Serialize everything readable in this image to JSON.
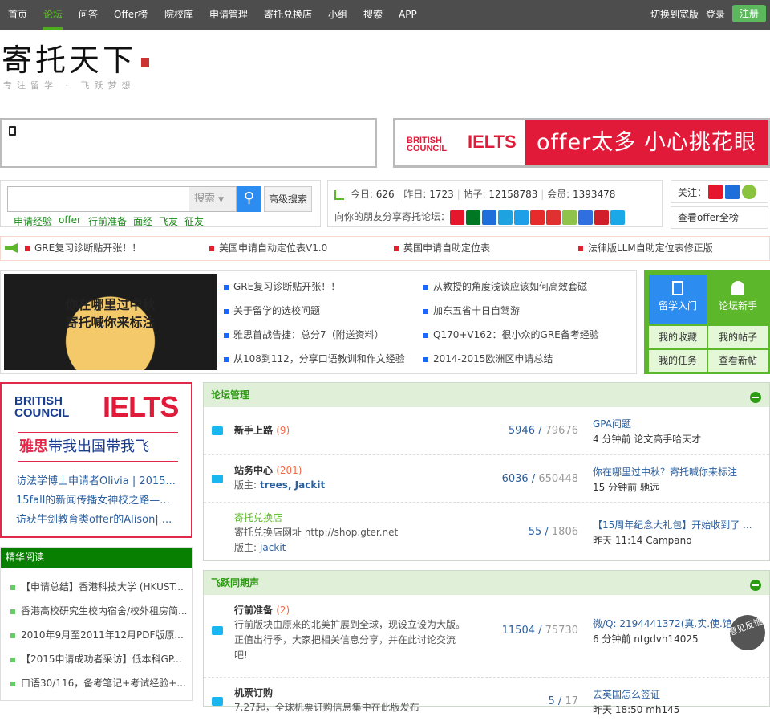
{
  "nav": {
    "items": [
      "首页",
      "论坛",
      "问答",
      "Offer榜",
      "院校库",
      "申请管理",
      "寄托兑换店",
      "小组",
      "搜索",
      "APP"
    ],
    "active": 1,
    "switch": "切换到宽版",
    "login": "登录",
    "register": "注册"
  },
  "logo": {
    "title": "寄托天下",
    "slogan": "专注留学 · 飞跃梦想"
  },
  "ad_top": {
    "brand1": "BRITISH COUNCIL",
    "brand2": "IELTS",
    "slogan": "offer太多  小心挑花眼"
  },
  "search": {
    "placeholder": "",
    "type": "搜索",
    "advanced": "高级搜索",
    "keywords": [
      "申请经验",
      "offer",
      "行前准备",
      "面经",
      "飞友",
      "征友"
    ]
  },
  "stats": {
    "today_label": "今日:",
    "today": "626",
    "yesterday_label": "昨日:",
    "yesterday": "1723",
    "posts_label": "帖子:",
    "posts": "12158783",
    "members_label": "会员:",
    "members": "1393478",
    "share_label": "向你的朋友分享寄托论坛："
  },
  "share_colors": [
    "#e6162d",
    "#007722",
    "#1e6fd9",
    "#1fa3e0",
    "#1ea0e8",
    "#e52b2b",
    "#e03030",
    "#8fc34a",
    "#2f6fe0",
    "#d01f2b",
    "#1aa8e8"
  ],
  "follow": {
    "label": "关注：",
    "offer_all": "查看offer全榜"
  },
  "ticker": [
    "GRE复习诊断贴开张！！",
    "美国申请自动定位表V1.0",
    "英国申请自助定位表",
    "法律版LLM自助定位表修正版"
  ],
  "banner": {
    "line1": "你在哪里过中秋",
    "line2": "寄托喊你来标注"
  },
  "headlines": [
    "GRE复习诊断贴开张！！",
    "从教授的角度浅谈应该如何高效套磁",
    "关于留学的选校问题",
    "加东五省十日自驾游",
    "雅思首战告捷：总分7（附送资料）",
    "Q170+V162：很小众的GRE备考经验",
    "从108到112，分享口语教训和作文经验",
    "2014-2015欧洲区申请总结"
  ],
  "quick": {
    "intro": "留学入门",
    "newbie": "论坛新手",
    "fav": "我的收藏",
    "myposts": "我的帖子",
    "tasks": "我的任务",
    "newposts": "查看新帖"
  },
  "ielts_box": {
    "brand1": "BRITISH COUNCIL",
    "brand2": "IELTS",
    "slogan_red": "雅思",
    "slogan": "带我出国带我飞",
    "links": [
      "访法学博士申请者Olivia | 2015...",
      "15fall的新闻传播女神校之路—...",
      "访获牛剑教育类offer的Alison| ..."
    ]
  },
  "featured": {
    "title": "精华阅读",
    "items": [
      "【申请总结】香港科技大学 (HKUST...",
      "香港高校研究生校内宿舍/校外租房简...",
      "2010年9月至2011年12月PDF版原...",
      "【2015申请成功者采访】低本科GP...",
      "口语30/116，备考笔记+考试经验+..."
    ]
  },
  "sections": [
    {
      "title": "论坛管理",
      "forums": [
        {
          "name": "新手上路",
          "count": "(9)",
          "threads": "5946",
          "posts": "79676",
          "last_title": "GPA问题",
          "last_meta": "4 分钟前 论文高手哈天才"
        },
        {
          "name": "站务中心",
          "count": "(201)",
          "mod_label": "版主:",
          "mods": "trees, Jackit",
          "threads": "6036",
          "posts": "650448",
          "last_title": "你在哪里过中秋？寄托喊你来标注",
          "last_meta": "15 分钟前 驰远"
        },
        {
          "name": "寄托兑换店",
          "desc": "寄托兑换店网址 http://shop.gter.net",
          "mod_label": "版主:",
          "mods": "Jackit",
          "threads": "55",
          "posts": "1806",
          "last_title": "【15周年纪念大礼包】开始收到了 ...",
          "last_meta": "昨天 11:14 Campano"
        }
      ]
    },
    {
      "title": "飞跃同期声",
      "forums": [
        {
          "name": "行前准备",
          "count": "(2)",
          "desc": "行前版块由原来的北美扩展到全球，现设立设为大版。正值出行季，大家把相关信息分享，并在此讨论交流吧!",
          "threads": "11504",
          "posts": "75730",
          "last_title": "微/Q: 2194441372(真.实.使.馆",
          "last_meta": "6 分钟前 ntgdvh14025"
        },
        {
          "name": "机票订购",
          "desc": "7.27起，全球机票订购信息集中在此版发布",
          "threads": "5",
          "posts": "17",
          "last_title": "去英国怎么签证",
          "last_meta": "昨天 18:50 mh145"
        }
      ]
    }
  ],
  "feedback": "意见反馈"
}
